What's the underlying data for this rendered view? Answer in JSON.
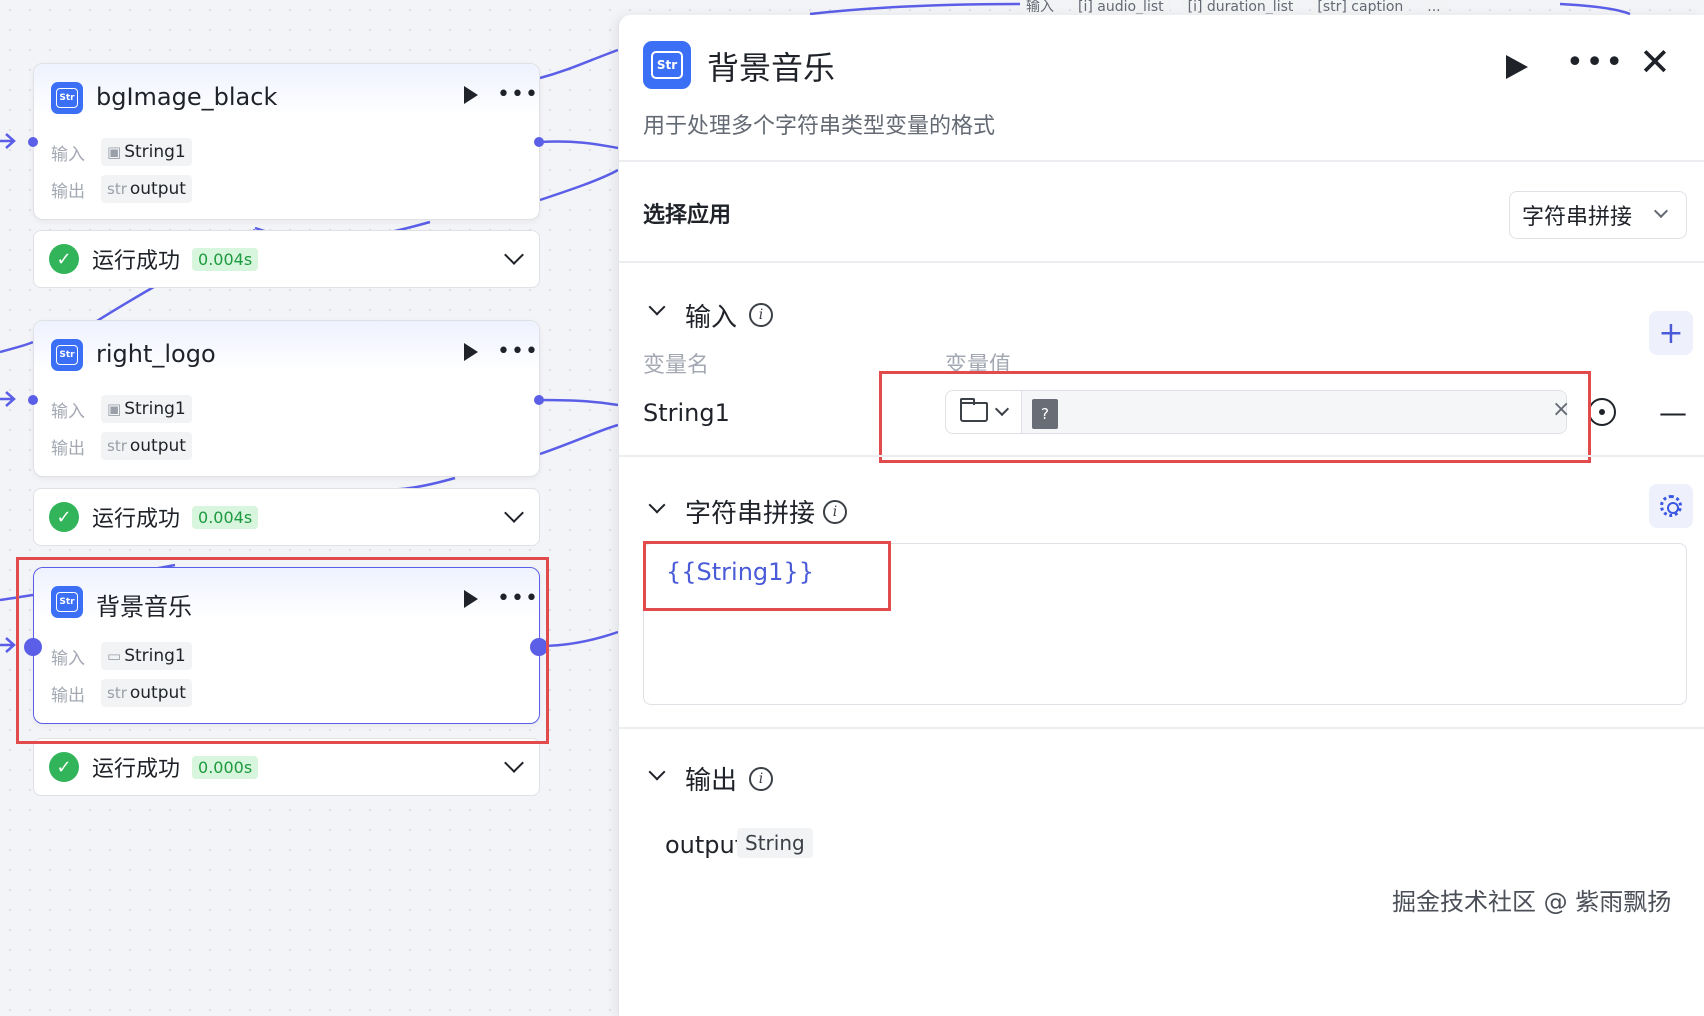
{
  "canvas": {
    "top_strip_tags": [
      "输入",
      "[i] audio_list",
      "[i] duration_list",
      "[str] caption",
      "..."
    ],
    "nodes": [
      {
        "title": "bgImage_black",
        "input_label": "输入",
        "input_var": "String1",
        "input_icon": "image-icon",
        "output_label": "输出",
        "output_prefix": "str",
        "output_var": "output",
        "status": "运行成功",
        "duration": "0.004s"
      },
      {
        "title": "right_logo",
        "input_label": "输入",
        "input_var": "String1",
        "input_icon": "image-icon",
        "output_label": "输出",
        "output_prefix": "str",
        "output_var": "output",
        "status": "运行成功",
        "duration": "0.004s"
      },
      {
        "title": "背景音乐",
        "input_label": "输入",
        "input_var": "String1",
        "input_icon": "folder-icon",
        "output_label": "输出",
        "output_prefix": "str",
        "output_var": "output",
        "status": "运行成功",
        "duration": "0.000s"
      }
    ]
  },
  "panel": {
    "icon_text": "Str",
    "title": "背景音乐",
    "description": "用于处理多个字符串类型变量的格式",
    "select_app_label": "选择应用",
    "select_app_value": "字符串拼接",
    "input_section": {
      "title": "输入",
      "col_name": "变量名",
      "col_value": "变量值",
      "var_name": "String1",
      "value_placeholder": "?"
    },
    "concat_section": {
      "title": "字符串拼接",
      "template": "{{String1}}"
    },
    "output_section": {
      "title": "输出",
      "name": "output",
      "type": "String"
    }
  },
  "watermark": "掘金技术社区 @ 紫雨飘扬",
  "colors": {
    "accent": "#5b5fe8",
    "brand": "#3b6ff5",
    "success": "#32b55a",
    "highlight": "#e24b4b"
  }
}
